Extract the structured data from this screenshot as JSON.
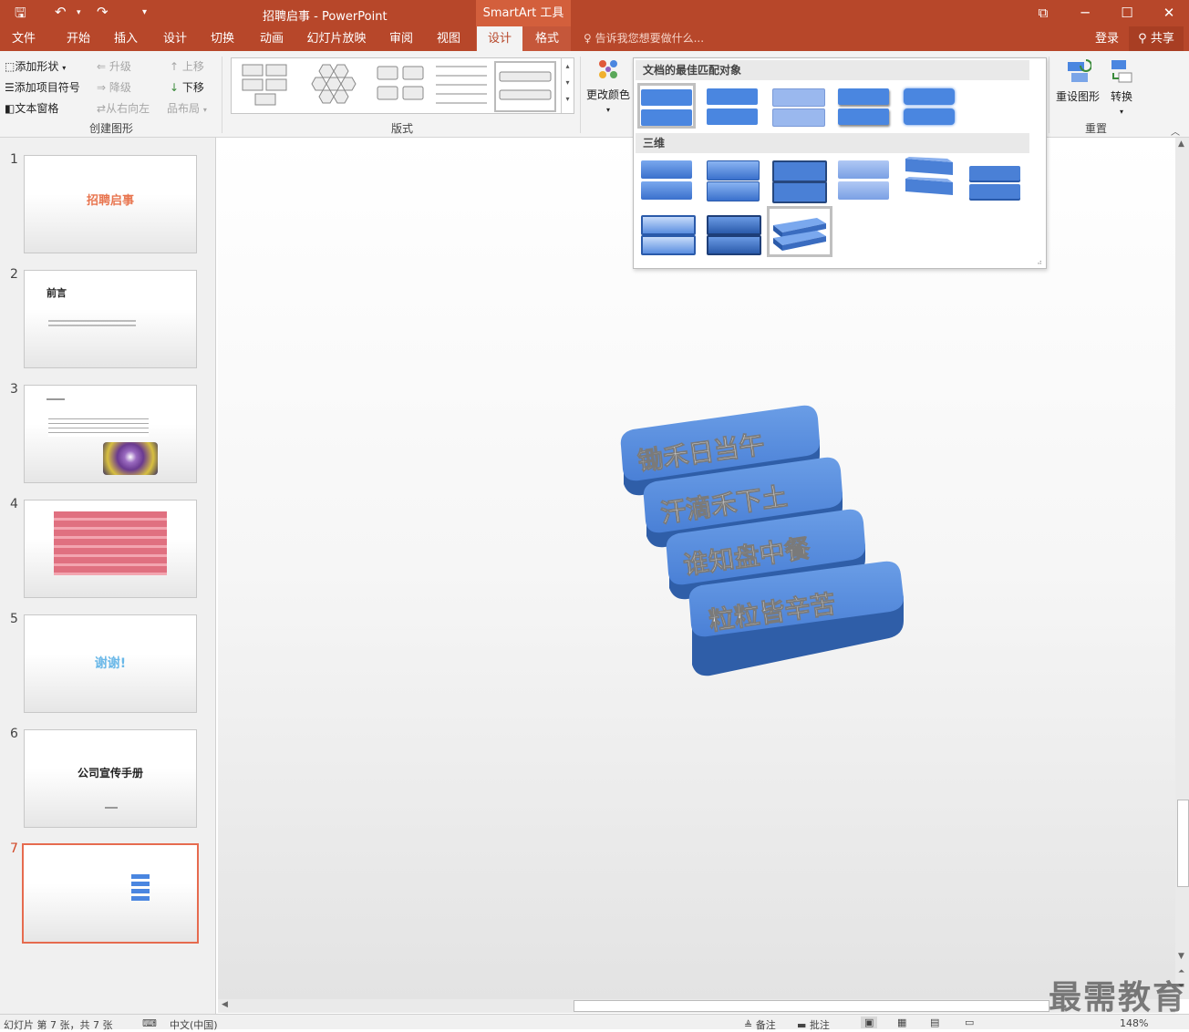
{
  "window": {
    "title": "招聘启事 - PowerPoint",
    "context_tool": "SmartArt 工具"
  },
  "tabs": [
    "文件",
    "开始",
    "插入",
    "设计",
    "切换",
    "动画",
    "幻灯片放映",
    "审阅",
    "视图",
    "设计",
    "格式"
  ],
  "tell_me": "告诉我您想要做什么...",
  "account": {
    "login": "登录",
    "share": "共享"
  },
  "ribbon": {
    "create_graphic": {
      "add_shape": "添加形状",
      "add_bullet": "添加项目符号",
      "text_pane": "文本窗格",
      "promote": "升级",
      "demote": "降级",
      "rtl": "从右向左",
      "move_up": "上移",
      "move_down": "下移",
      "layout": "布局",
      "label": "创建图形"
    },
    "layouts_label": "版式",
    "change_colors": "更改颜色",
    "reset": {
      "reset_graphic": "重设图形",
      "convert": "转换",
      "label": "重置"
    }
  },
  "style_gallery": {
    "section_best": "文档的最佳匹配对象",
    "section_3d": "三维"
  },
  "slides": [
    {
      "num": "1",
      "title": "招聘启事"
    },
    {
      "num": "2",
      "title": "前言"
    },
    {
      "num": "3",
      "title": ""
    },
    {
      "num": "4",
      "title": ""
    },
    {
      "num": "5",
      "title": "谢谢!"
    },
    {
      "num": "6",
      "title": "公司宣传手册"
    },
    {
      "num": "7",
      "title": ""
    }
  ],
  "smartart_items": [
    "锄禾日当午",
    "汗滴禾下土",
    "谁知盘中餐",
    "粒粒皆辛苦"
  ],
  "status": {
    "slide_info": "幻灯片 第 7 张，共 7 张",
    "language": "中文(中国)",
    "notes": "备注",
    "comments": "批注",
    "zoom": "148%"
  },
  "watermark": "最需教育",
  "colors": {
    "brand": "#b7472a",
    "smartart_blue": "#4a86e0"
  }
}
